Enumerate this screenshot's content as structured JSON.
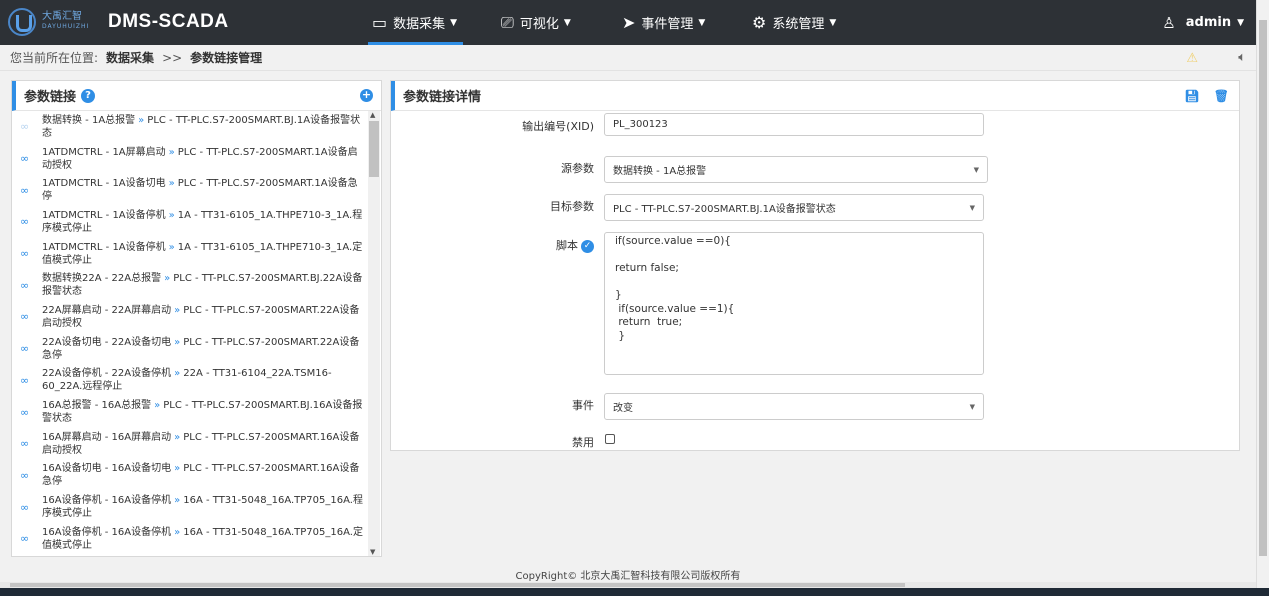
{
  "header": {
    "logo_cn": "大禹汇智",
    "logo_en": "DAYUHUIZHI",
    "app_title": "DMS-SCADA",
    "nav": [
      {
        "label": "数据采集",
        "icon": "monitor-icon",
        "active": true
      },
      {
        "label": "可视化",
        "icon": "camera-icon",
        "active": false
      },
      {
        "label": "事件管理",
        "icon": "send-icon",
        "active": false
      },
      {
        "label": "系统管理",
        "icon": "gear-icon",
        "active": false
      }
    ],
    "user": "admin"
  },
  "breadcrumb": {
    "prefix": "您当前所在位置:",
    "level1": "数据采集",
    "sep": ">>",
    "level2": "参数链接管理"
  },
  "left_panel": {
    "title": "参数链接",
    "help": "?",
    "add": "+",
    "items": [
      {
        "source": "数据转换 - 1A总报警",
        "target": "PLC - TT-PLC.S7-200SMART.BJ.1A设备报警状态",
        "faded": true
      },
      {
        "source": "1ATDMCTRL - 1A屏幕启动",
        "target": "PLC - TT-PLC.S7-200SMART.1A设备启动授权",
        "faded": false
      },
      {
        "source": "1ATDMCTRL - 1A设备切电",
        "target": "PLC - TT-PLC.S7-200SMART.1A设备急停",
        "faded": false
      },
      {
        "source": "1ATDMCTRL - 1A设备停机",
        "target": "1A - TT31-6105_1A.THPE710-3_1A.程序模式停止",
        "faded": false
      },
      {
        "source": "1ATDMCTRL - 1A设备停机",
        "target": "1A - TT31-6105_1A.THPE710-3_1A.定值模式停止",
        "faded": false
      },
      {
        "source": "数据转换22A - 22A总报警",
        "target": "PLC - TT-PLC.S7-200SMART.BJ.22A设备报警状态",
        "faded": false
      },
      {
        "source": "22A屏幕启动 - 22A屏幕启动",
        "target": "PLC - TT-PLC.S7-200SMART.22A设备启动授权",
        "faded": false
      },
      {
        "source": "22A设备切电 - 22A设备切电",
        "target": "PLC - TT-PLC.S7-200SMART.22A设备急停",
        "faded": false
      },
      {
        "source": "22A设备停机 - 22A设备停机",
        "target": "22A - TT31-6104_22A.TSM16-60_22A.远程停止",
        "faded": false
      },
      {
        "source": "16A总报警 - 16A总报警",
        "target": "PLC - TT-PLC.S7-200SMART.BJ.16A设备报警状态",
        "faded": false
      },
      {
        "source": "16A屏幕启动 - 16A屏幕启动",
        "target": "PLC - TT-PLC.S7-200SMART.16A设备启动授权",
        "faded": false
      },
      {
        "source": "16A设备切电 - 16A设备切电",
        "target": "PLC - TT-PLC.S7-200SMART.16A设备急停",
        "faded": false
      },
      {
        "source": "16A设备停机 - 16A设备停机",
        "target": "16A - TT31-5048_16A.TP705_16A.程序模式停止",
        "faded": false
      },
      {
        "source": "16A设备停机 - 16A设备停机",
        "target": "16A - TT31-5048_16A.TP705_16A.定值模式停止",
        "faded": false
      }
    ]
  },
  "detail": {
    "title": "参数链接详情",
    "xid_label": "输出编号(XID)",
    "xid_value": "PL_300123",
    "source_label": "源参数",
    "source_value": "数据转换 - 1A总报警",
    "target_label": "目标参数",
    "target_value": "PLC - TT-PLC.S7-200SMART.BJ.1A设备报警状态",
    "script_label": "脚本",
    "script_value": "if(source.value ==0){\n\nreturn false;\n\n}\n if(source.value ==1){\n return  true;\n }",
    "event_label": "事件",
    "event_value": "改变",
    "disable_label": "禁用"
  },
  "footer": "CopyRight© 北京大禹汇智科技有限公司版权所有"
}
